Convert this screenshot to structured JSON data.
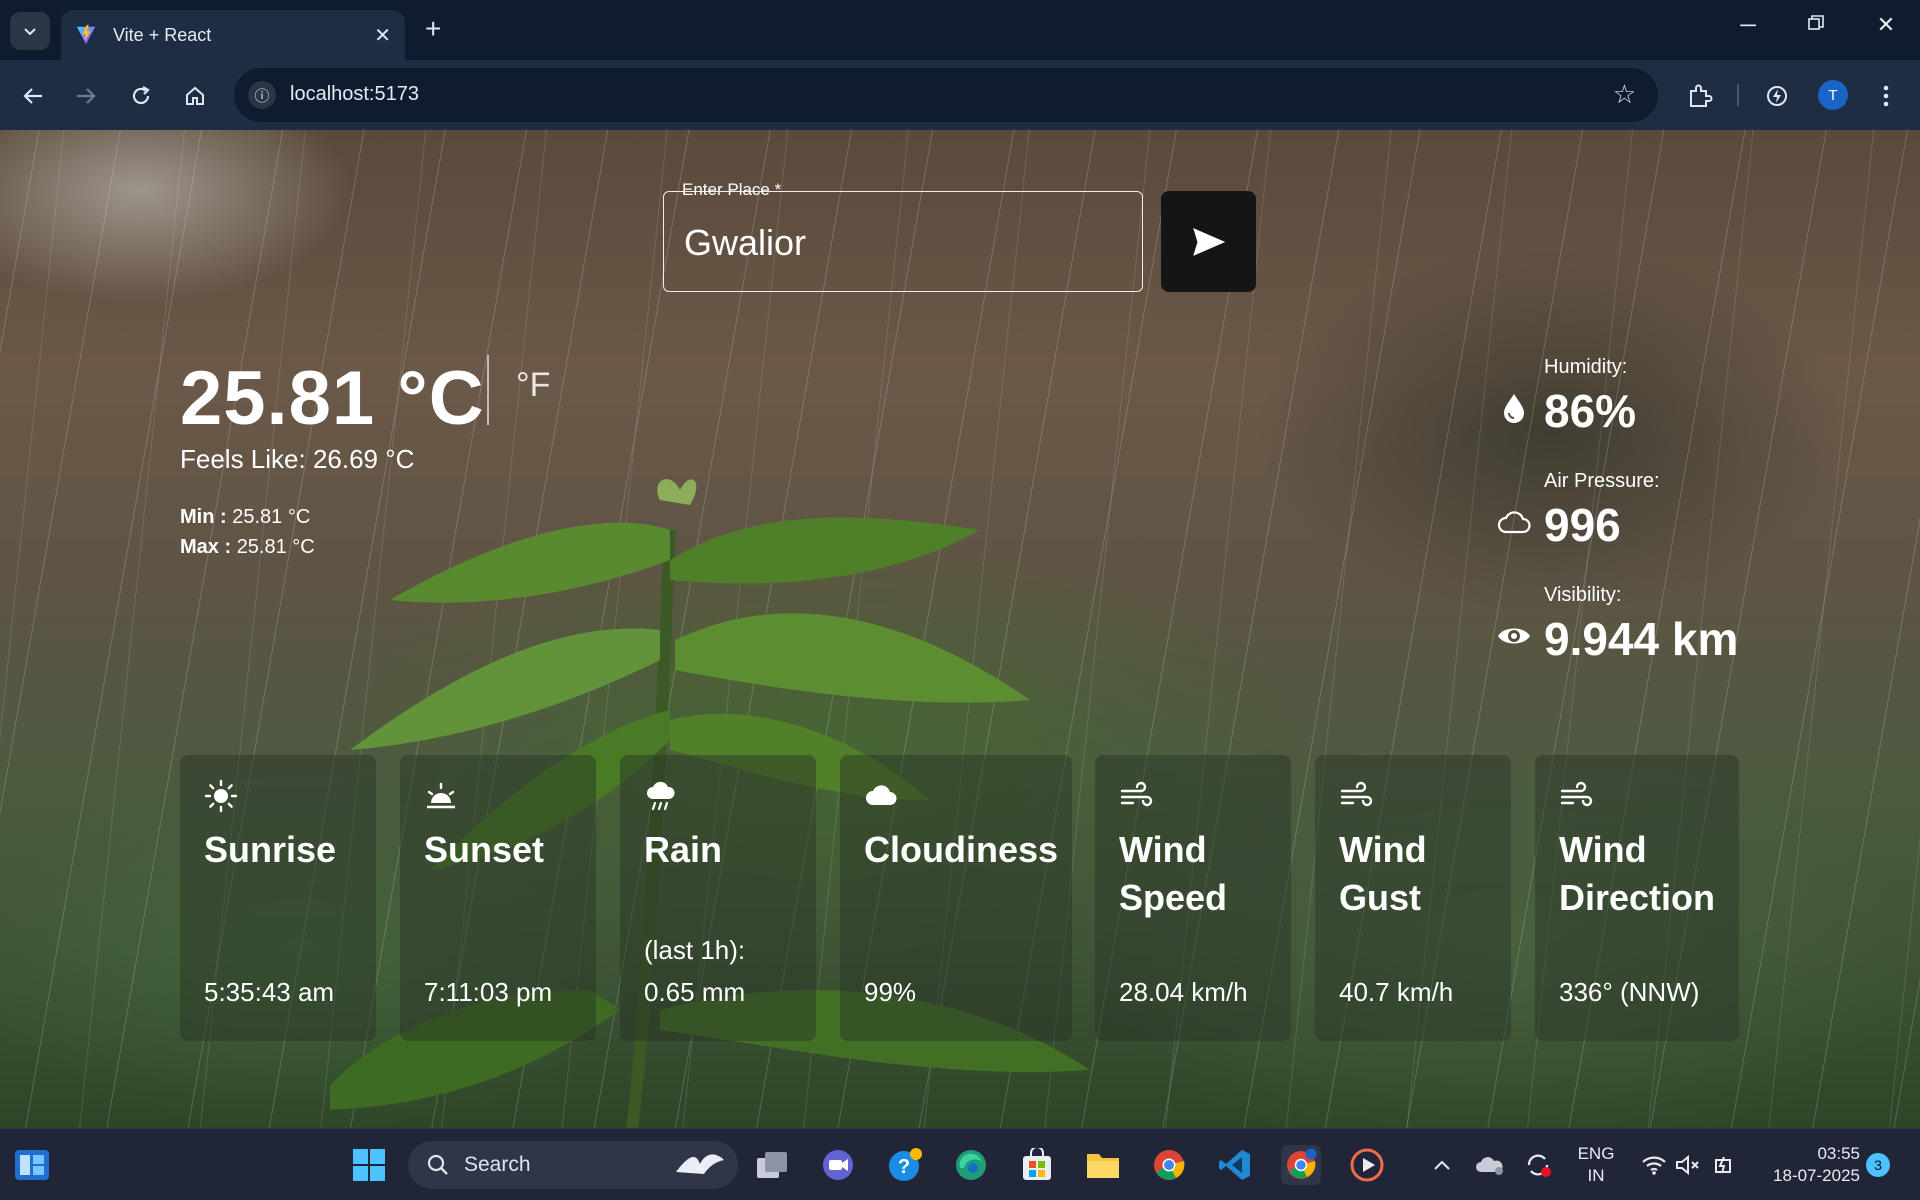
{
  "browser": {
    "tab_title": "Vite + React",
    "url": "localhost:5173",
    "profile_initial": "T"
  },
  "search": {
    "label": "Enter Place *",
    "value": "Gwalior"
  },
  "weather": {
    "temperature": "25.81 °C",
    "alt_unit": "°F",
    "feels_like": "Feels Like: 26.69 °C",
    "min_label": "Min :",
    "min_value": "25.81 °C",
    "max_label": "Max :",
    "max_value": "25.81 °C"
  },
  "stats": [
    {
      "label": "Humidity:",
      "value": "86%",
      "icon": "water-drop-icon"
    },
    {
      "label": "Air Pressure:",
      "value": "996",
      "icon": "cloud-outline-icon"
    },
    {
      "label": "Visibility:",
      "value": "9.944 km",
      "icon": "eye-icon"
    }
  ],
  "cards": [
    {
      "icon": "sun-icon",
      "title": "Sunrise",
      "value": "5:35:43 am"
    },
    {
      "icon": "sunset-icon",
      "title": "Sunset",
      "value": "7:11:03 pm"
    },
    {
      "icon": "rain-icon",
      "title": "Rain",
      "value_line1": "(last 1h):",
      "value": "0.65 mm"
    },
    {
      "icon": "cloud-icon",
      "title": "Cloudiness",
      "value": "99%"
    },
    {
      "icon": "wind-icon",
      "title_line1": "Wind",
      "title_line2": "Speed",
      "value": "28.04 km/h"
    },
    {
      "icon": "wind-icon",
      "title_line1": "Wind",
      "title_line2": "Gust",
      "value": "40.7 km/h"
    },
    {
      "icon": "wind-icon",
      "title_line1": "Wind",
      "title_line2": "Direction",
      "value": "336° (NNW)"
    }
  ],
  "taskbar": {
    "search_label": "Search",
    "language_line1": "ENG",
    "language_line2": "IN",
    "time": "03:55",
    "date": "18-07-2025",
    "notification_count": "3"
  },
  "colors": {
    "chrome_dark": "#0f1b2e",
    "chrome_toolbar": "#1e2d44",
    "send_button": "#151515",
    "taskbar": "#202638"
  }
}
